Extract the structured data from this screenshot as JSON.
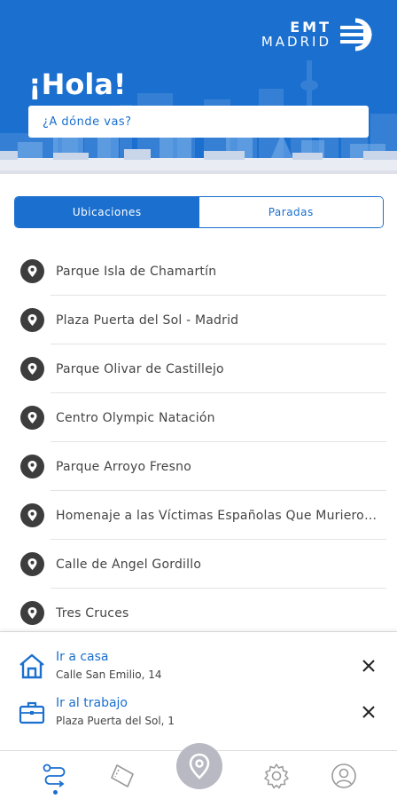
{
  "header": {
    "greeting": "¡Hola!",
    "logo_line1": "EMT",
    "logo_line2": "MADRID",
    "search_placeholder": "¿A dónde vas?",
    "brand_color": "#1a6fcf"
  },
  "tabs": [
    {
      "label": "Ubicaciones",
      "active": true
    },
    {
      "label": "Paradas",
      "active": false
    }
  ],
  "locations": [
    "Parque Isla de Chamartín",
    "Plaza Puerta del Sol - Madrid",
    "Parque Olivar de Castillejo",
    "Centro Olympic Natación",
    "Parque Arroyo Fresno",
    "Homenaje a las Víctimas Españolas Que Murieron en los Campos de Concentración Nazis",
    "Calle de Ángel Gordillo",
    "Tres Cruces"
  ],
  "shortcuts": {
    "home": {
      "title": "Ir a casa",
      "address": "Calle San Emilio, 14",
      "icon": "home-icon"
    },
    "work": {
      "title": "Ir al trabajo",
      "address": "Plaza Puerta del Sol, 1",
      "icon": "briefcase-icon"
    }
  },
  "bottom_nav": [
    "route-icon",
    "ticket-icon",
    "location-pin-icon",
    "gear-icon",
    "user-icon"
  ]
}
